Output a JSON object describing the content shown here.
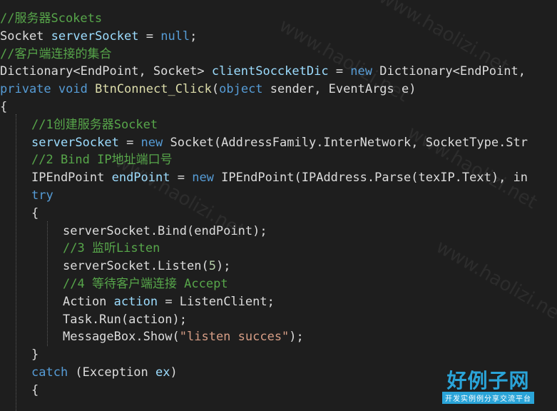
{
  "code_lines": [
    {
      "indent": 0,
      "tokens": [
        {
          "c": "c",
          "t": "//服务器Scokets"
        }
      ]
    },
    {
      "indent": 0,
      "tokens": [
        {
          "c": "p",
          "t": "Socket "
        },
        {
          "c": "v",
          "t": "serverSocket"
        },
        {
          "c": "p",
          "t": " = "
        },
        {
          "c": "k",
          "t": "null"
        },
        {
          "c": "p",
          "t": ";"
        }
      ]
    },
    {
      "indent": 0,
      "tokens": [
        {
          "c": "c",
          "t": "//客户端连接的集合"
        }
      ]
    },
    {
      "indent": 0,
      "tokens": [
        {
          "c": "p",
          "t": "Dictionary<EndPoint, Socket> "
        },
        {
          "c": "v",
          "t": "clientSoccketDic"
        },
        {
          "c": "p",
          "t": " = "
        },
        {
          "c": "k",
          "t": "new"
        },
        {
          "c": "p",
          "t": " Dictionary<EndPoint,"
        }
      ]
    },
    {
      "indent": 0,
      "tokens": [
        {
          "c": "k",
          "t": "private"
        },
        {
          "c": "p",
          "t": " "
        },
        {
          "c": "k",
          "t": "void"
        },
        {
          "c": "p",
          "t": " "
        },
        {
          "c": "m",
          "t": "BtnConnect_Click"
        },
        {
          "c": "p",
          "t": "("
        },
        {
          "c": "k",
          "t": "object"
        },
        {
          "c": "p",
          "t": " sender, EventArgs e)"
        }
      ]
    },
    {
      "indent": 0,
      "tokens": [
        {
          "c": "p",
          "t": "{"
        }
      ]
    },
    {
      "indent": 1,
      "tokens": [
        {
          "c": "c",
          "t": "//1创建服务器Socket"
        }
      ]
    },
    {
      "indent": 1,
      "tokens": [
        {
          "c": "v",
          "t": "serverSocket"
        },
        {
          "c": "p",
          "t": " = "
        },
        {
          "c": "k",
          "t": "new"
        },
        {
          "c": "p",
          "t": " Socket(AddressFamily.InterNetwork, SocketType.Str"
        }
      ]
    },
    {
      "indent": 1,
      "tokens": [
        {
          "c": "c",
          "t": "//2 Bind IP地址端口号"
        }
      ]
    },
    {
      "indent": 1,
      "tokens": [
        {
          "c": "p",
          "t": "IPEndPoint "
        },
        {
          "c": "v",
          "t": "endPoint"
        },
        {
          "c": "p",
          "t": " = "
        },
        {
          "c": "k",
          "t": "new"
        },
        {
          "c": "p",
          "t": " IPEndPoint(IPAddress.Parse(texIP.Text), in"
        }
      ]
    },
    {
      "indent": 1,
      "tokens": [
        {
          "c": "k",
          "t": "try"
        }
      ]
    },
    {
      "indent": 1,
      "tokens": [
        {
          "c": "p",
          "t": "{"
        }
      ]
    },
    {
      "indent": 2,
      "tokens": [
        {
          "c": "p",
          "t": "serverSocket.Bind(endPoint);"
        }
      ]
    },
    {
      "indent": 2,
      "tokens": [
        {
          "c": "c",
          "t": "//3 监听Listen"
        }
      ]
    },
    {
      "indent": 2,
      "tokens": [
        {
          "c": "p",
          "t": "serverSocket.Listen("
        },
        {
          "c": "n",
          "t": "5"
        },
        {
          "c": "p",
          "t": ");"
        }
      ]
    },
    {
      "indent": 2,
      "tokens": [
        {
          "c": "c",
          "t": "//4 等待客户端连接 Accept"
        }
      ]
    },
    {
      "indent": 2,
      "tokens": [
        {
          "c": "p",
          "t": "Action "
        },
        {
          "c": "v",
          "t": "action"
        },
        {
          "c": "p",
          "t": " = ListenClient;"
        }
      ]
    },
    {
      "indent": 2,
      "tokens": [
        {
          "c": "p",
          "t": "Task.Run(action);"
        }
      ]
    },
    {
      "indent": 2,
      "tokens": [
        {
          "c": "p",
          "t": "MessageBox.Show("
        },
        {
          "c": "s",
          "t": "\"listen succes\""
        },
        {
          "c": "p",
          "t": ");"
        }
      ]
    },
    {
      "indent": 1,
      "tokens": [
        {
          "c": "p",
          "t": "}"
        }
      ]
    },
    {
      "indent": 1,
      "tokens": [
        {
          "c": "k",
          "t": "catch"
        },
        {
          "c": "p",
          "t": " (Exception "
        },
        {
          "c": "v",
          "t": "ex"
        },
        {
          "c": "p",
          "t": ")"
        }
      ]
    },
    {
      "indent": 1,
      "tokens": [
        {
          "c": "p",
          "t": "{"
        }
      ]
    }
  ],
  "colors": {
    "background": "#1e1e1e",
    "comment": "#57a64a",
    "keyword": "#569cd6",
    "variable": "#9cdcfe",
    "string": "#d69d85",
    "number": "#b5cea8",
    "text": "#dcdcdc",
    "logo": "#2aa4d8"
  },
  "watermark": {
    "logo_title": "好例子网",
    "logo_subtitle": "开发实例例分享交流平台",
    "pattern_text": "www.haolizi.net"
  }
}
